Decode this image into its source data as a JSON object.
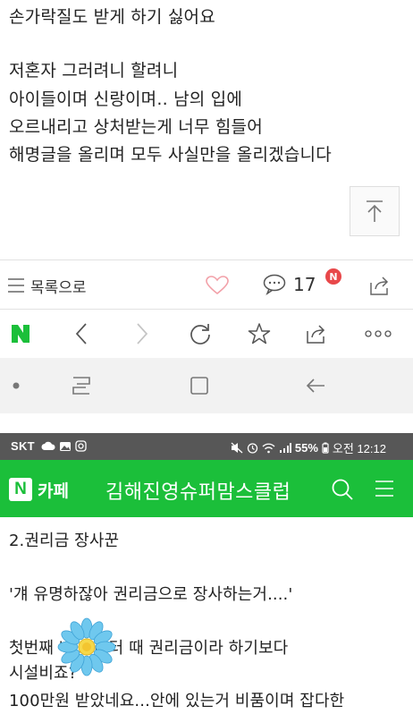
{
  "post": {
    "lines": [
      "손가락질도 받게 하기 싫어요",
      "저혼자 그러려니 할려니",
      "아이들이며 신랑이며.. 남의 입에",
      "오르내리고 상처받는게 너무 힘들어",
      "해명글을 올리며 모두 사실만을 올리겠습니다"
    ]
  },
  "action_bar": {
    "list_label": "목록으로",
    "comment_count": "17",
    "new_badge": "N"
  },
  "status_bar": {
    "carrier": "SKT",
    "battery": "55%",
    "time": "오전 12:12"
  },
  "cafe": {
    "logo_letter": "N",
    "service_name": "카페",
    "title": "김해진영슈퍼맘스클럽"
  },
  "article": {
    "lines": [
      "2.권리금 장사꾼",
      "",
      "'걔 유명하잖아 권리금으로 장사하는거....'",
      "",
      "첫번째        네 노리터 때 권리금이라 하기보다",
      "시설비죠?",
      "100만원 받았네요...안에 있는거 비품이며 잡다한"
    ]
  },
  "colors": {
    "naver_green": "#1bbf3a",
    "badge_red": "#e8484a",
    "status_gray": "#575757"
  }
}
